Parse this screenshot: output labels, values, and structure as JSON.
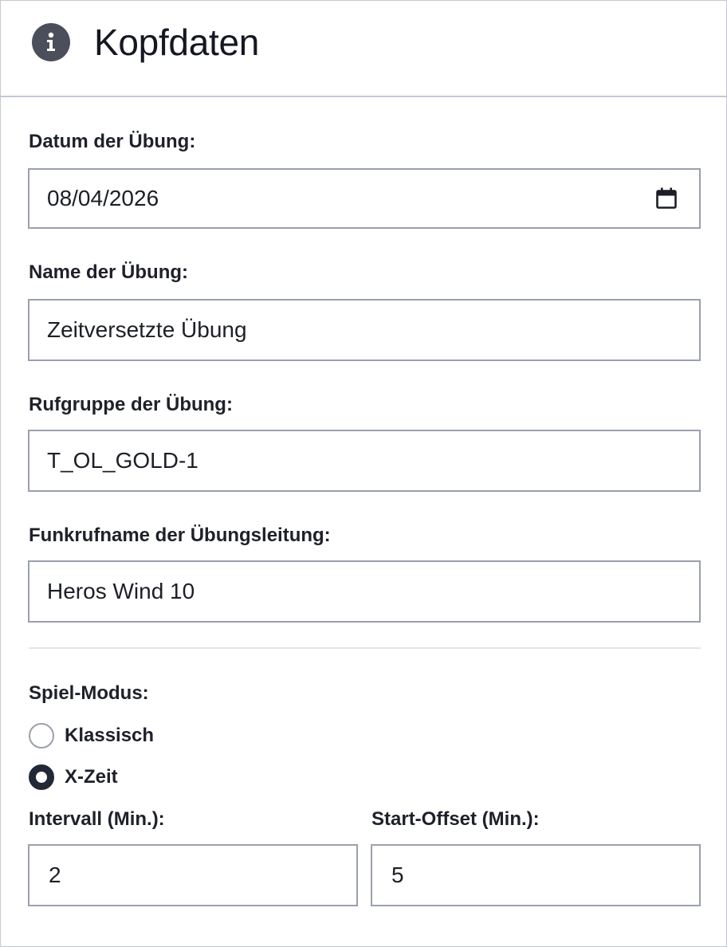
{
  "header": {
    "icon": "info-icon",
    "title": "Kopfdaten"
  },
  "form": {
    "date": {
      "label": "Datum der Übung:",
      "value": "08/04/2026",
      "icon": "calendar-icon"
    },
    "name": {
      "label": "Name der Übung:",
      "value": "Zeitversetzte Übung"
    },
    "call_group": {
      "label": "Rufgruppe der Übung:",
      "value": "T_OL_GOLD-1"
    },
    "radio_callsign": {
      "label": "Funkrufname der Übungsleitung:",
      "value": "Heros Wind 10"
    },
    "game_mode": {
      "label": "Spiel-Modus:",
      "options": [
        {
          "label": "Klassisch",
          "checked": false
        },
        {
          "label": "X-Zeit",
          "checked": true
        }
      ]
    },
    "interval": {
      "label": "Intervall (Min.):",
      "value": "2"
    },
    "start_offset": {
      "label": "Start-Offset (Min.):",
      "value": "5"
    }
  },
  "colors": {
    "border": "#9aa0ab",
    "card_border": "#c3c8d2",
    "icon_dark": "#4b4f5b",
    "radio_checked": "#222838",
    "text": "#1c1f26"
  }
}
